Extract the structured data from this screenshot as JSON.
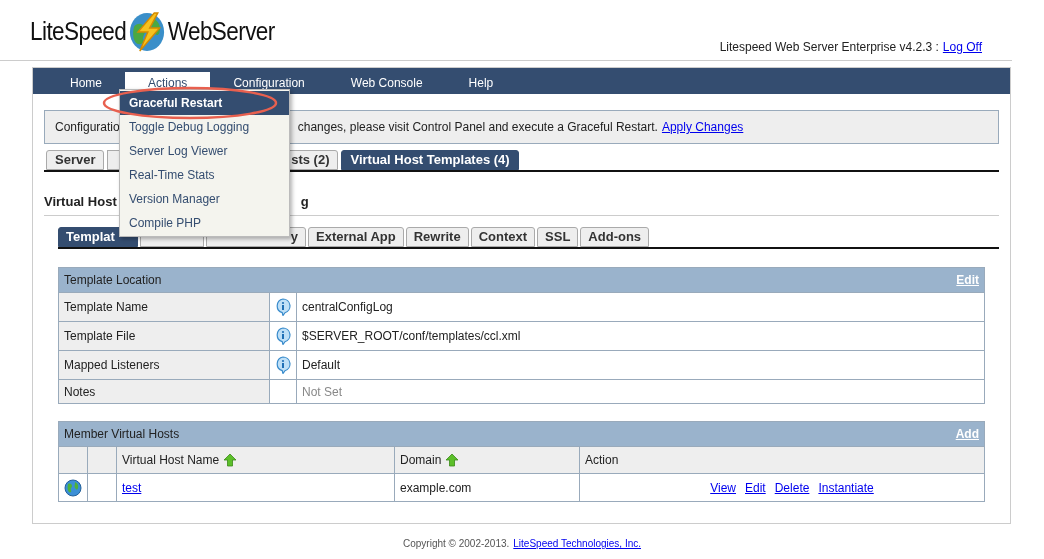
{
  "header": {
    "logo_left": "LiteSpeed",
    "logo_right": "WebServer",
    "version": "Litespeed Web Server Enterprise v4.2.3 :",
    "logoff": "Log Off"
  },
  "nav": [
    {
      "label": "Home",
      "selected": false
    },
    {
      "label": "Actions",
      "selected": true
    },
    {
      "label": "Configuration",
      "selected": false
    },
    {
      "label": "Web Console",
      "selected": false
    },
    {
      "label": "Help",
      "selected": false
    }
  ],
  "menu": [
    {
      "label": "Graceful Restart",
      "selected": true
    },
    {
      "label": "Toggle Debug Logging",
      "selected": false
    },
    {
      "label": "Server Log Viewer",
      "selected": false
    },
    {
      "label": "Real-Time Stats",
      "selected": false
    },
    {
      "label": "Version Manager",
      "selected": false
    },
    {
      "label": "Compile PHP",
      "selected": false
    }
  ],
  "notice": {
    "start": "Configuratio",
    "rest": "changes, please visit Control Panel and execute a Graceful Restart.",
    "link": "Apply Changes"
  },
  "tabs": [
    {
      "label": "Server",
      "selected": false
    },
    {
      "label": "sts (2)",
      "selected": false
    },
    {
      "label": "Virtual Host Templates (4)",
      "selected": true
    }
  ],
  "heading": {
    "start": "Virtual Host",
    "end": "g"
  },
  "subtabs": [
    {
      "label": "Templat",
      "selected": true
    },
    {
      "label": "y",
      "selected": false
    },
    {
      "label": "External App",
      "selected": false
    },
    {
      "label": "Rewrite",
      "selected": false
    },
    {
      "label": "Context",
      "selected": false
    },
    {
      "label": "SSL",
      "selected": false
    },
    {
      "label": "Add-ons",
      "selected": false
    }
  ],
  "location": {
    "title": "Template Location",
    "action": "Edit",
    "rows": [
      {
        "label": "Template Name",
        "info": true,
        "value": "centralConfigLog",
        "set": true
      },
      {
        "label": "Template File",
        "info": true,
        "value": "$SERVER_ROOT/conf/templates/ccl.xml",
        "set": true
      },
      {
        "label": "Mapped Listeners",
        "info": true,
        "value": "Default",
        "set": true
      },
      {
        "label": "Notes",
        "info": false,
        "value": "Not Set",
        "set": false
      }
    ]
  },
  "members": {
    "title": "Member Virtual Hosts",
    "action": "Add",
    "columns": [
      "Virtual Host Name",
      "Domain",
      "Action"
    ],
    "rows": [
      {
        "name": "test",
        "domain": "example.com",
        "actions": [
          "View",
          "Edit",
          "Delete",
          "Instantiate"
        ]
      }
    ]
  },
  "footer": {
    "text": "Copyright © 2002-2013.",
    "link": "LiteSpeed Technologies, Inc."
  }
}
